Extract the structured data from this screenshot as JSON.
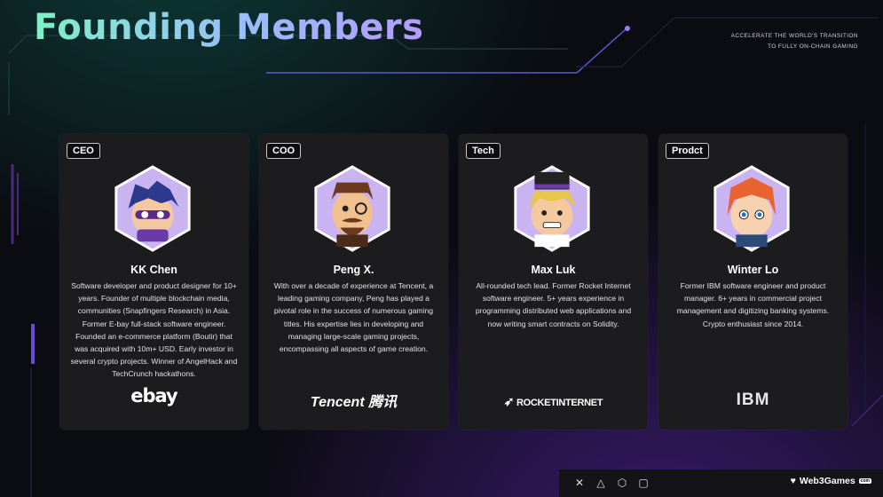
{
  "header": {
    "title": "Founding Members",
    "tagline_line1": "ACCELERATE THE WORLD'S TRANSITION",
    "tagline_line2": "TO FULLY ON-CHAIN GAMING"
  },
  "members": [
    {
      "role": "CEO",
      "name": "KK Chen",
      "bio": "Software developer and product designer for 10+ years. Founder of multiple blockchain media, communities (Snapfingers Research) in Asia. Former E-bay full-stack software engineer. Founded an e-commerce platform (Boutir) that was acquired with 10m+ USD. Early investor in several crypto projects. Winner of AngelHack and TechCrunch hackathons.",
      "company": "ebay",
      "avatar_hair": "#2b3a8c"
    },
    {
      "role": "COO",
      "name": "Peng X.",
      "bio": "With over a decade of experience at Tencent, a leading gaming company, Peng has played a pivotal role in the success of numerous gaming titles. His expertise lies in developing and managing large-scale gaming projects, encompassing all aspects of game creation.",
      "company": "Tencent 腾讯",
      "avatar_hair": "#6b3a1e"
    },
    {
      "role": "Tech",
      "name": "Max Luk",
      "bio": "All-rounded tech lead. Former Rocket Internet software engineer. 5+ years experience in programming distributed web applications and now writing smart contracts on Solidity.",
      "company": "ROCKETINTERNET",
      "avatar_hair": "#e8c64a"
    },
    {
      "role": "Prodct",
      "name": "Winter Lo",
      "bio": "Former IBM software engineer and product manager. 6+ years in commercial project management and digitizing banking systems. Crypto enthusiast since 2014.",
      "company": "IBM",
      "avatar_hair": "#e8632e"
    }
  ],
  "footer": {
    "icons": [
      "x-icon",
      "triangle-icon",
      "hexagon-icon",
      "shield-icon"
    ],
    "brand": "Web3Games",
    "brand_tag": "com"
  },
  "colors": {
    "accent_green": "#7ff0c6",
    "accent_purple": "#9b7bff",
    "avatar_bg": "#c9b3f0"
  }
}
